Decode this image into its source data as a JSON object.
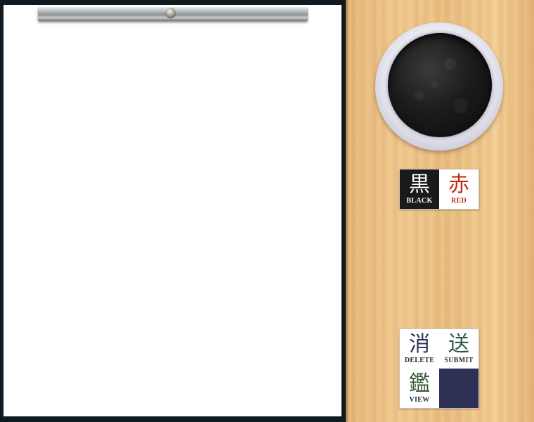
{
  "ink_colors": [
    {
      "kanji": "黒",
      "label": "BLACK",
      "color": "#1a1a1a"
    },
    {
      "kanji": "赤",
      "label": "RED",
      "color": "#c52b14"
    }
  ],
  "actions": {
    "delete": {
      "kanji": "消",
      "label": "DELETE"
    },
    "submit": {
      "kanji": "送",
      "label": "SUBMIT"
    },
    "view": {
      "kanji": "鑑",
      "label": "VIEW"
    }
  },
  "colors": {
    "wood": "#f0c98e",
    "paper": "#ffffff",
    "frame": "#0e1a20",
    "blank_tile": "#2e3056"
  }
}
